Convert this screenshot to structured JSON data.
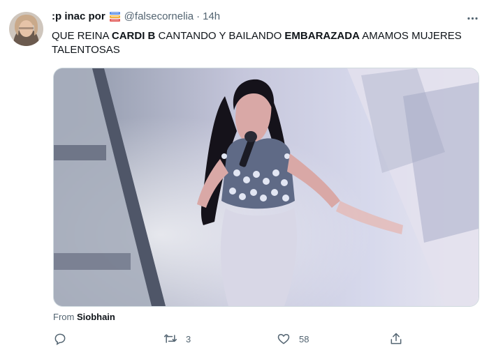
{
  "tweet": {
    "display_name": ":p inac por",
    "handle": "@falsecornelia",
    "separator": "·",
    "time": "14h",
    "text": {
      "p1": "QUE REINA ",
      "b1": "CARDI B",
      "p2": " CANTANDO Y BAILANDO ",
      "b2": "EMBARAZADA",
      "p3": " AMAMOS MUJERES TALENTOSAS"
    },
    "from_label": "From",
    "from_name": "Siobhain",
    "reply_count": "",
    "retweet_count": "3",
    "like_count": "58"
  },
  "icons": {
    "avatar": "avatar",
    "emoji": "books-emoji",
    "more": "more-icon",
    "reply": "reply-icon",
    "retweet": "retweet-icon",
    "like": "heart-icon",
    "share": "share-icon"
  },
  "colors": {
    "secondary_text": "#536471",
    "primary_text": "#0f1419",
    "border": "#cfd9de"
  }
}
